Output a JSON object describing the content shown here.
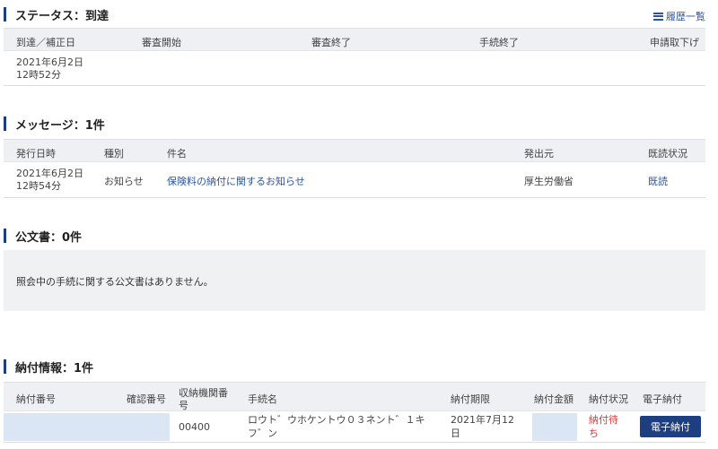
{
  "status": {
    "title": "ステータス：到達",
    "history_link": "履歴一覧",
    "columns": [
      "到達／補正日",
      "審査開始",
      "審査終了",
      "手続終了",
      "申請取下げ"
    ],
    "row": {
      "arrival_date": "2021年6月2日",
      "arrival_time": "12時52分"
    }
  },
  "messages": {
    "title": "メッセージ：1件",
    "columns": [
      "発行日時",
      "種別",
      "件名",
      "発出元",
      "既読状況"
    ],
    "rows": [
      {
        "date": "2021年6月2日",
        "time": "12時54分",
        "type": "お知らせ",
        "subject": "保険料の納付に関するお知らせ",
        "sender": "厚生労働省",
        "read_status": "既読"
      }
    ]
  },
  "official_docs": {
    "title": "公文書：0件",
    "empty_message": "照会中の手続に関する公文書はありません。"
  },
  "payment": {
    "title": "納付情報：1件",
    "columns": [
      "納付番号",
      "確認番号",
      "収納機関番",
      "号",
      "手続名",
      "納付期限",
      "納付金額",
      "納付状況",
      "電子納付"
    ],
    "rows": [
      {
        "institution_no": "00400",
        "procedure_line1": "ロウト゛ウホケントウ０３ネント゛１キ",
        "procedure_line2": "フ゛ン",
        "deadline_line1": "2021年7月12",
        "deadline_line2": "日",
        "status_line1": "納付待",
        "status_line2": "ち",
        "pay_button": "電子納付"
      }
    ]
  }
}
